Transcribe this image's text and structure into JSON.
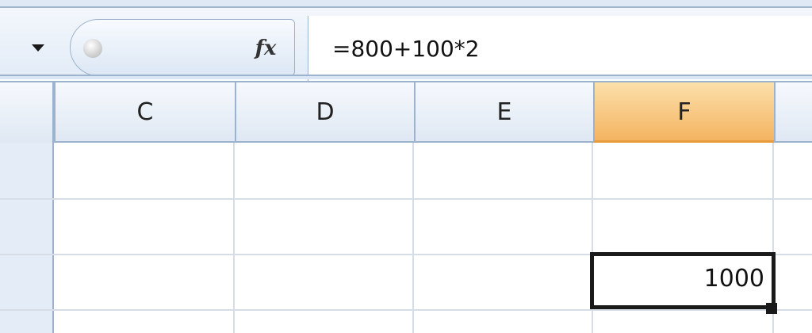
{
  "formula_bar": {
    "formula": "=800+100*2",
    "fx_label": "fx"
  },
  "columns": [
    "C",
    "D",
    "E",
    "F"
  ],
  "active_column": "F",
  "active_cell": {
    "value": "1000"
  }
}
